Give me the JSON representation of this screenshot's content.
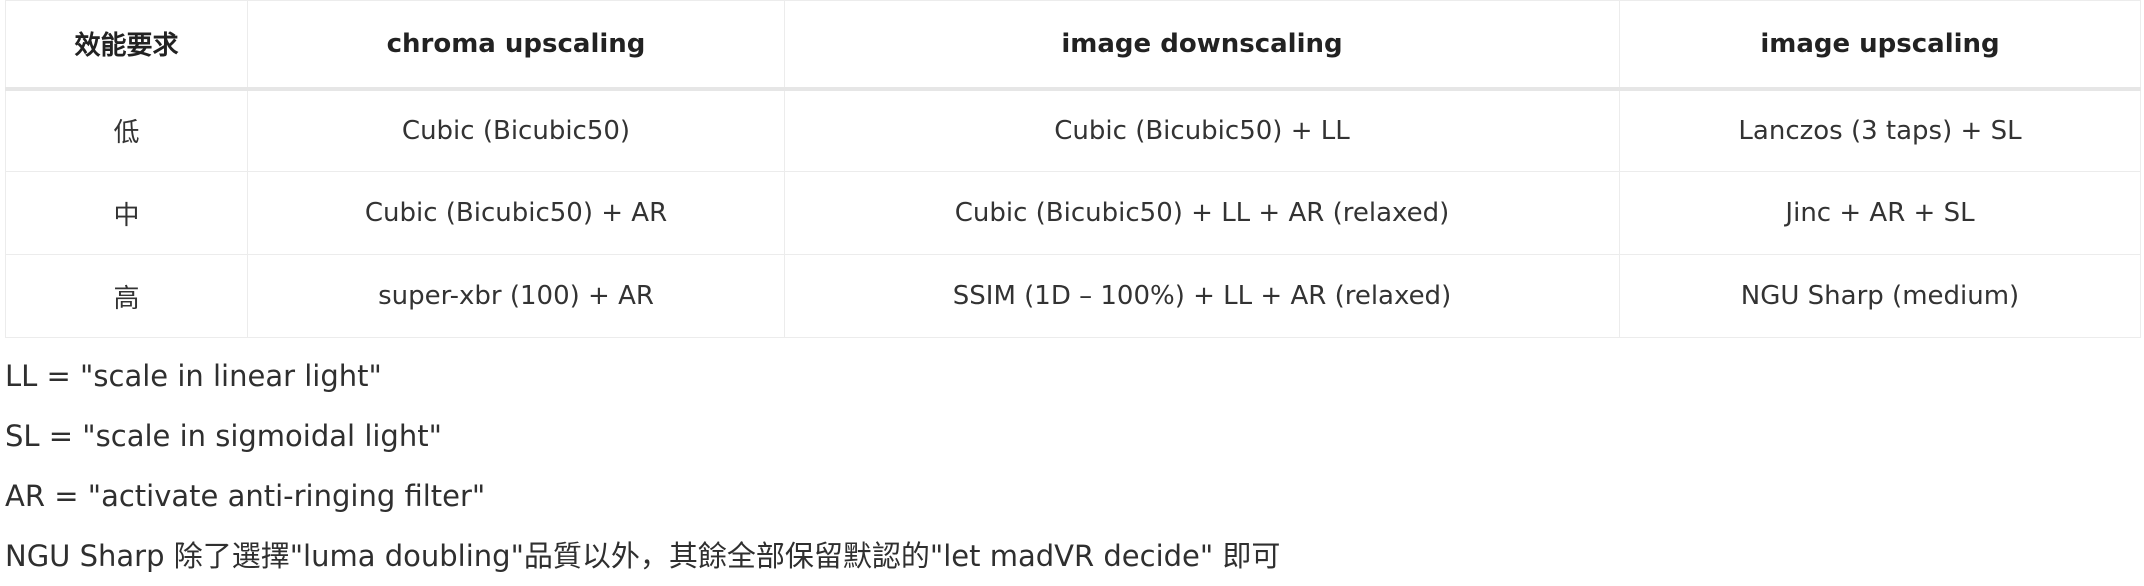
{
  "table": {
    "headers": [
      "效能要求",
      "chroma upscaling",
      "image downscaling",
      "image upscaling"
    ],
    "rows": [
      [
        "低",
        "Cubic (Bicubic50)",
        "Cubic (Bicubic50) + LL",
        "Lanczos (3 taps) + SL"
      ],
      [
        "中",
        "Cubic (Bicubic50) + AR",
        "Cubic (Bicubic50) + LL + AR (relaxed)",
        "Jinc + AR + SL"
      ],
      [
        "高",
        "super-xbr (100) + AR",
        "SSIM (1D – 100%) + LL + AR (relaxed)",
        "NGU Sharp (medium)"
      ]
    ]
  },
  "notes": [
    "LL = \"scale in linear light\"",
    "SL = \"scale in sigmoidal light\"",
    "AR = \"activate anti-ringing filter\"",
    "NGU Sharp 除了選擇\"luma doubling\"品質以外，其餘全部保留默認的\"let madVR decide\" 即可"
  ]
}
